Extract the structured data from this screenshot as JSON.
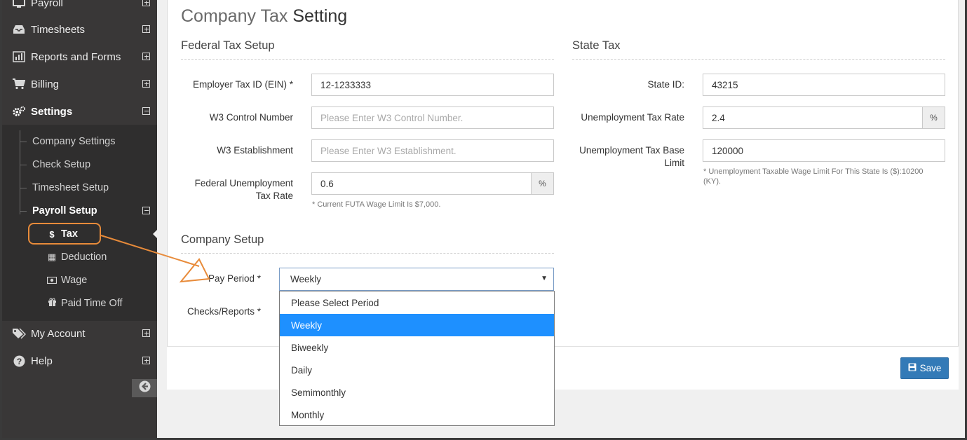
{
  "sidebar": {
    "payroll_label": "Payroll",
    "timesheets_label": "Timesheets",
    "reports_label": "Reports and Forms",
    "billing_label": "Billing",
    "settings_label": "Settings",
    "company_settings_label": "Company Settings",
    "check_setup_label": "Check Setup",
    "timesheet_setup_label": "Timesheet Setup",
    "payroll_setup_label": "Payroll Setup",
    "tax_label": "Tax",
    "deduction_label": "Deduction",
    "wage_label": "Wage",
    "pto_label": "Paid Time Off",
    "my_account_label": "My Account",
    "help_label": "Help"
  },
  "page": {
    "title_light": "Company Tax",
    "title_strong": "Setting"
  },
  "federal": {
    "section_title": "Federal Tax Setup",
    "ein_label": "Employer Tax ID (EIN) *",
    "ein_value": "12-1233333",
    "w3_control_label": "W3 Control Number",
    "w3_control_placeholder": "Please Enter W3 Control Number.",
    "w3_establishment_label": "W3 Establishment",
    "w3_establishment_placeholder": "Please Enter W3 Establishment.",
    "futa_label_line1": "Federal Unemployment",
    "futa_label_line2": "Tax Rate",
    "futa_value": "0.6",
    "futa_addon": "%",
    "futa_help": "* Current FUTA Wage Limit Is $7,000."
  },
  "state": {
    "section_title": "State Tax",
    "state_id_label": "State ID:",
    "state_id_value": "43215",
    "unemp_rate_label": "Unemployment Tax Rate",
    "unemp_rate_value": "2.4",
    "unemp_rate_addon": "%",
    "unemp_base_label_line1": "Unemployment Tax Base",
    "unemp_base_label_line2": "Limit",
    "unemp_base_value": "120000",
    "unemp_help_line1": "* Unemployment Taxable Wage Limit For This State Is ($):10200",
    "unemp_help_line2": "(KY)."
  },
  "company": {
    "section_title": "Company Setup",
    "pay_period_label": "Pay Period *",
    "pay_period_value": "Weekly",
    "checks_reports_label": "Checks/Reports *",
    "options": [
      "Please Select Period",
      "Weekly",
      "Biweekly",
      "Daily",
      "Semimonthly",
      "Monthly"
    ],
    "selected_option": "Weekly"
  },
  "footer": {
    "save_label": "Save"
  },
  "colors": {
    "sidebar_bg": "#393737",
    "accent": "#337ab7",
    "highlight": "#e88b3a",
    "selected_option": "#1e90ff"
  }
}
